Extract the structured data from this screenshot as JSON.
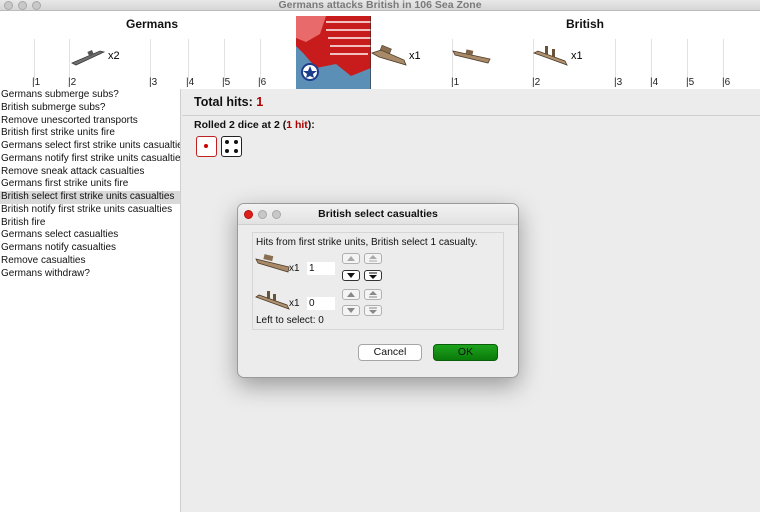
{
  "window": {
    "title": "Germans attacks British in 106 Sea Zone"
  },
  "board": {
    "attacker_label": "Germans",
    "defender_label": "British",
    "attacker_units": [
      {
        "icon": "submarine-icon",
        "count": "x2"
      }
    ],
    "defender_units": [
      {
        "icon": "transport-ship-icon",
        "count": "x1"
      },
      {
        "icon": "destroyer-ship-icon",
        "count": ""
      },
      {
        "icon": "cruiser-ship-icon",
        "count": "x1"
      }
    ],
    "attacker_ticks": [
      "1",
      "2",
      "3",
      "4",
      "5",
      "6"
    ],
    "defender_ticks": [
      "1",
      "2",
      "3",
      "4",
      "5",
      "6"
    ]
  },
  "steps": {
    "items": [
      "Germans submerge subs?",
      "British submerge subs?",
      "Remove unescorted transports",
      "British first strike units fire",
      "Germans select first strike units casualties",
      "Germans notify first strike units casualties",
      "Remove sneak attack casualties",
      "Germans first strike units fire",
      "British select first strike units casualties",
      "British notify first strike units casualties",
      "British fire",
      "Germans select casualties",
      "Germans notify casualties",
      "Remove casualties",
      "Germans withdraw?"
    ],
    "selected_index": 8
  },
  "results": {
    "total_label": "Total hits:",
    "total_value": "1",
    "rolled_prefix": "Rolled 2 dice at 2 (",
    "rolled_hits": "1 hit",
    "rolled_suffix": "):",
    "dice": [
      1,
      4
    ]
  },
  "dialog": {
    "title": "British select casualties",
    "message": "Hits from first strike units,  British select 1 casualty.",
    "rows": [
      {
        "icon": "transport-ship-icon",
        "count": "x1",
        "value": "1"
      },
      {
        "icon": "cruiser-ship-icon",
        "count": "x1",
        "value": "0"
      }
    ],
    "left_label": "Left to select: 0",
    "cancel_label": "Cancel",
    "ok_label": "OK"
  },
  "colors": {
    "hit_red": "#aa0000",
    "ok_green": "#12921a",
    "selected_row": "#d9d9d9"
  }
}
